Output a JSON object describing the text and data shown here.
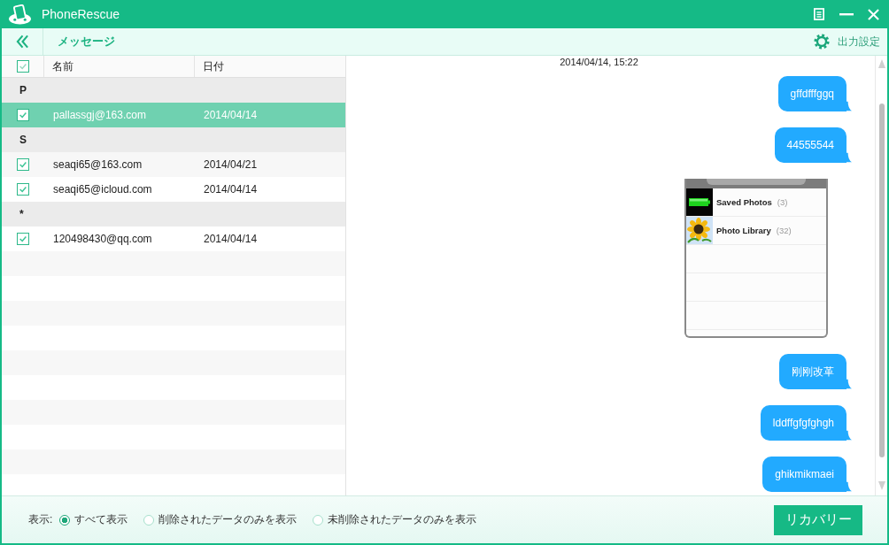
{
  "window": {
    "title": "PhoneRescue"
  },
  "toolbar": {
    "title": "メッセージ",
    "export_label": "出力設定"
  },
  "contacts": {
    "select_all_checked": true,
    "columns": [
      "名前",
      "日付"
    ],
    "groups": [
      {
        "letter": "P",
        "items": [
          {
            "name": "pallassgj@163.com",
            "date": "2014/04/14",
            "checked": true,
            "selected": true
          }
        ]
      },
      {
        "letter": "S",
        "items": [
          {
            "name": "seaqi65@163.com",
            "date": "2014/04/21",
            "checked": true,
            "selected": false
          },
          {
            "name": "seaqi65@icloud.com",
            "date": "2014/04/14",
            "checked": true,
            "selected": false
          }
        ]
      },
      {
        "letter": "*",
        "items": [
          {
            "name": "120498430@qq.com",
            "date": "2014/04/14",
            "checked": true,
            "selected": false
          }
        ]
      }
    ]
  },
  "conversation": {
    "timestamp": "2014/04/14, 15:22",
    "messages": [
      {
        "kind": "text",
        "text": "gffdfffggq"
      },
      {
        "kind": "text",
        "text": "44555544"
      },
      {
        "kind": "image",
        "albums": [
          {
            "kind": "battery",
            "name": "Saved Photos",
            "count": "(3)"
          },
          {
            "kind": "sunflower",
            "name": "Photo Library",
            "count": "(32)"
          }
        ]
      },
      {
        "kind": "text",
        "text": "刚刚改革"
      },
      {
        "kind": "text",
        "text": "lddffgfgfghgh"
      },
      {
        "kind": "text",
        "text": "ghikmikmaei"
      }
    ]
  },
  "filter": {
    "label": "表示:",
    "options": [
      {
        "label": "すべて表示",
        "selected": true
      },
      {
        "label": "削除されたデータのみを表示",
        "selected": false
      },
      {
        "label": "未削除されたデータのみを表示",
        "selected": false
      }
    ]
  },
  "recover_button": {
    "label": "リカバリー"
  }
}
